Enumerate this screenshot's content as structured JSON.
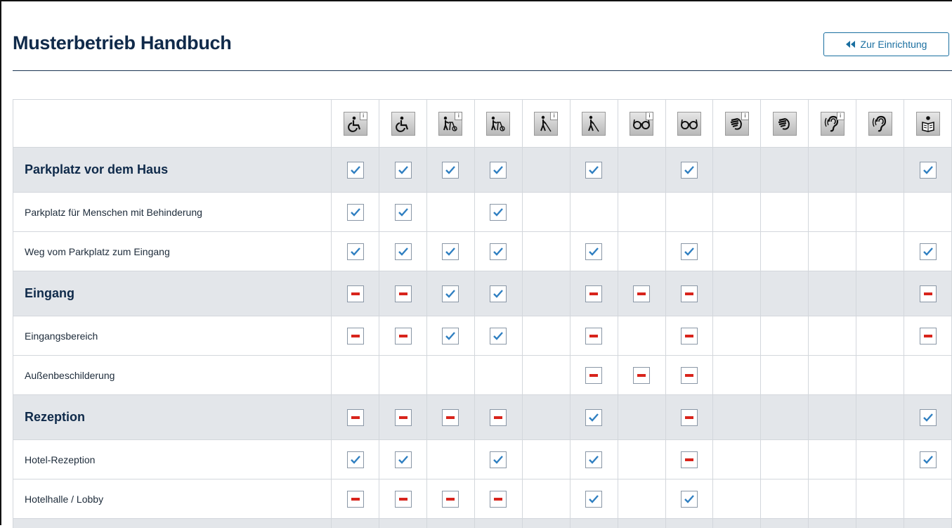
{
  "header": {
    "title": "Musterbetrieb Handbuch",
    "back_label": "Zur Einrichtung"
  },
  "columns": [
    {
      "icon": "wheelchair-icon",
      "info": true
    },
    {
      "icon": "wheelchair-icon",
      "info": false
    },
    {
      "icon": "walker-icon",
      "info": true
    },
    {
      "icon": "walker-icon",
      "info": false
    },
    {
      "icon": "blind-cane-icon",
      "info": true
    },
    {
      "icon": "blind-cane-icon",
      "info": false
    },
    {
      "icon": "glasses-icon",
      "info": true
    },
    {
      "icon": "glasses-icon",
      "info": false
    },
    {
      "icon": "sign-language-icon",
      "info": true
    },
    {
      "icon": "sign-language-icon",
      "info": false
    },
    {
      "icon": "ear-icon",
      "info": true
    },
    {
      "icon": "ear-icon",
      "info": false
    },
    {
      "icon": "reading-person-icon",
      "info": false
    }
  ],
  "rows": [
    {
      "type": "section",
      "label": "Parkplatz vor dem Haus",
      "cells": [
        "check",
        "check",
        "check",
        "check",
        "",
        "check",
        "",
        "check",
        "",
        "",
        "",
        "",
        "check"
      ]
    },
    {
      "type": "item",
      "label": "Parkplatz für Menschen mit Behinderung",
      "cells": [
        "check",
        "check",
        "",
        "check",
        "",
        "",
        "",
        "",
        "",
        "",
        "",
        "",
        ""
      ]
    },
    {
      "type": "item",
      "label": "Weg vom Parkplatz zum Eingang",
      "cells": [
        "check",
        "check",
        "check",
        "check",
        "",
        "check",
        "",
        "check",
        "",
        "",
        "",
        "",
        "check"
      ]
    },
    {
      "type": "section",
      "label": "Eingang",
      "cells": [
        "minus",
        "minus",
        "check",
        "check",
        "",
        "minus",
        "minus",
        "minus",
        "",
        "",
        "",
        "",
        "minus"
      ]
    },
    {
      "type": "item",
      "label": "Eingangsbereich",
      "cells": [
        "minus",
        "minus",
        "check",
        "check",
        "",
        "minus",
        "",
        "minus",
        "",
        "",
        "",
        "",
        "minus"
      ]
    },
    {
      "type": "item",
      "label": "Außenbeschilderung",
      "cells": [
        "",
        "",
        "",
        "",
        "",
        "minus",
        "minus",
        "minus",
        "",
        "",
        "",
        "",
        ""
      ]
    },
    {
      "type": "section",
      "label": "Rezeption",
      "cells": [
        "minus",
        "minus",
        "minus",
        "minus",
        "",
        "check",
        "",
        "minus",
        "",
        "",
        "",
        "",
        "check"
      ]
    },
    {
      "type": "item",
      "label": "Hotel-Rezeption",
      "cells": [
        "check",
        "check",
        "",
        "check",
        "",
        "check",
        "",
        "minus",
        "",
        "",
        "",
        "",
        "check"
      ]
    },
    {
      "type": "item",
      "label": "Hotelhalle / Lobby",
      "cells": [
        "minus",
        "minus",
        "minus",
        "minus",
        "",
        "check",
        "",
        "check",
        "",
        "",
        "",
        "",
        ""
      ]
    }
  ],
  "colors": {
    "check": "#2f7fc1",
    "minus": "#d8241c",
    "section_bg": "#e3e6ea",
    "title": "#102a4a",
    "accent": "#1a6fa0"
  }
}
